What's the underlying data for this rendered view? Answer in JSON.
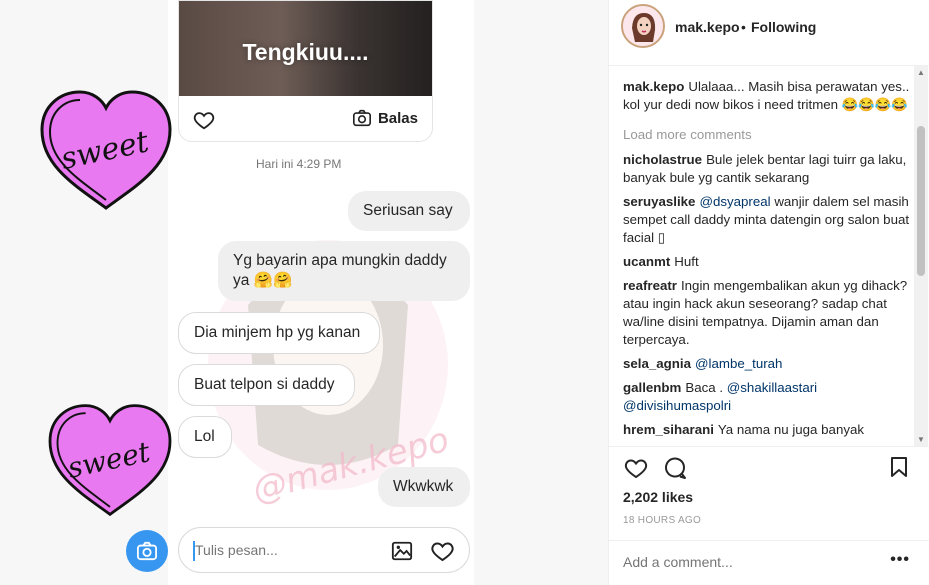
{
  "post": {
    "photo_caption": "Tengkiuu....",
    "photo_reply_label": "Balas",
    "timestamp": "Hari ini 4:29 PM",
    "messages": [
      {
        "text": "Seriusan say"
      },
      {
        "text_line1": "Yg bayarin apa mungkin daddy",
        "text_line2": "ya 🤗🤗"
      },
      {
        "text": "Dia minjem hp yg kanan"
      },
      {
        "text": "Buat telpon si daddy"
      },
      {
        "text": "Lol"
      },
      {
        "text": "Wkwkwk"
      }
    ],
    "sticker_text": "sweet",
    "watermark": "@mak.kepo",
    "composer_placeholder": "Tulis pesan..."
  },
  "header": {
    "username": "mak.kepo",
    "separator": "•",
    "follow_label": "Following"
  },
  "caption": {
    "username": "mak.kepo",
    "text": "Ulalaaa... Masih bisa perawatan yes.. I kol yur dedi now bikos i need tritmen 😂😂😂😂"
  },
  "load_more": "Load more comments",
  "comments": [
    {
      "user": "nicholastrue",
      "text": "Bule jelek bentar lagi tuirr ga laku, banyak bule yg cantik sekarang"
    },
    {
      "user": "seruyaslike",
      "mention": "@dsyapreal",
      "text": "wanjir dalem sel masih sempet call daddy minta datengin org salon buat facial ▯"
    },
    {
      "user": "ucanmt",
      "text": "Huft"
    },
    {
      "user": "reafreatr",
      "text": "Ingin mengembalikan akun yg dihack? atau ingin hack akun seseorang? sadap chat wa/line disini tempatnya. Dijamin aman dan terpercaya."
    },
    {
      "user": "sela_agnia",
      "mention": "@lambe_turah",
      "text": ""
    },
    {
      "user": "gallenbm",
      "pre": "Baca .",
      "mention": "@shakillaastari",
      "mention2": "@divisihumaspolri"
    },
    {
      "user": "hrem_siharani",
      "text": "Ya nama nu juga banyak"
    }
  ],
  "likes": "2,202 likes",
  "time_ago": "18 HOURS AGO",
  "add_comment_placeholder": "Add a comment...",
  "more_label": "•••",
  "colors": {
    "accent": "#3797f0",
    "mention": "#003569",
    "heart_pink": "#e879f0"
  }
}
